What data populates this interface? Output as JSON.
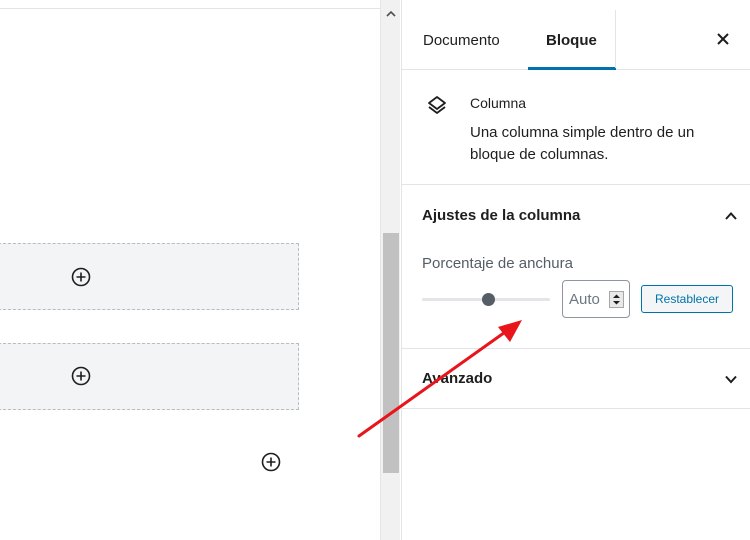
{
  "sidebar": {
    "tabs": [
      {
        "label": "Documento"
      },
      {
        "label": "Bloque"
      }
    ],
    "block_card": {
      "title": "Columna",
      "description": "Una columna simple dentro de un bloque de columnas."
    },
    "column_settings": {
      "title": "Ajustes de la columna",
      "width_label": "Porcentaje de anchura",
      "width_value": "Auto",
      "reset_label": "Restablecer"
    },
    "advanced": {
      "title": "Avanzado"
    }
  },
  "colors": {
    "accent": "#0073aa",
    "annotation_arrow": "#e8151b"
  },
  "icons": {
    "block": "layers-icon",
    "inserter": "plus-circle-icon",
    "close": "close-icon"
  }
}
